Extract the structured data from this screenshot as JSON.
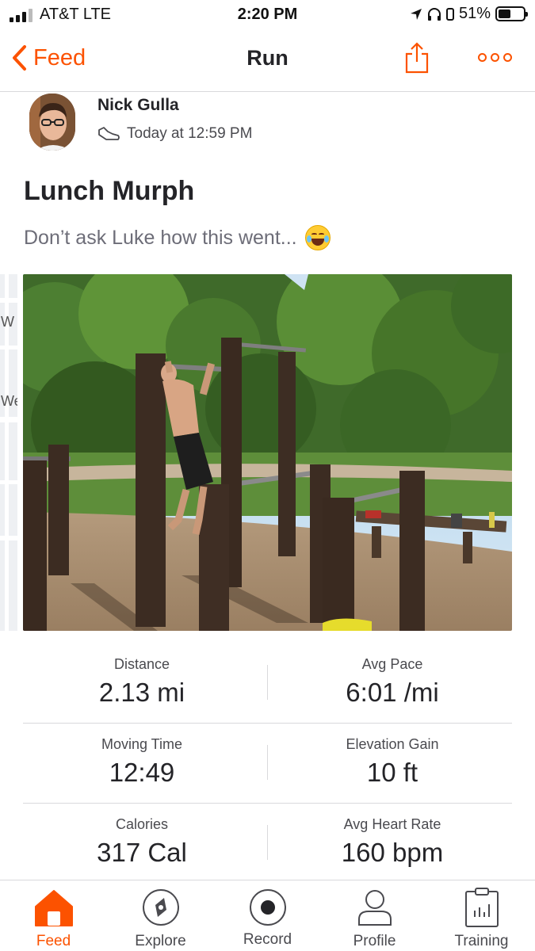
{
  "status_bar": {
    "carrier": "AT&T  LTE",
    "time": "2:20 PM",
    "battery": "51%"
  },
  "nav": {
    "back_label": "Feed",
    "title": "Run"
  },
  "activity": {
    "athlete_name": "Nick Gulla",
    "timestamp": "Today at 12:59 PM",
    "title": "Lunch Murph",
    "description": "Don’t ask Luke how this went..."
  },
  "map_labels": [
    "W",
    "We"
  ],
  "stats": [
    {
      "left_label": "Distance",
      "left_value": "2.13 mi",
      "right_label": "Avg Pace",
      "right_value": "6:01 /mi"
    },
    {
      "left_label": "Moving Time",
      "left_value": "12:49",
      "right_label": "Elevation Gain",
      "right_value": "10 ft"
    },
    {
      "left_label": "Calories",
      "left_value": "317 Cal",
      "right_label": "Avg Heart Rate",
      "right_value": "160 bpm"
    }
  ],
  "tab_bar": [
    {
      "label": "Feed",
      "icon": "home-icon",
      "active": true
    },
    {
      "label": "Explore",
      "icon": "compass-icon",
      "active": false
    },
    {
      "label": "Record",
      "icon": "record-icon",
      "active": false
    },
    {
      "label": "Profile",
      "icon": "profile-icon",
      "active": false
    },
    {
      "label": "Training",
      "icon": "training-icon",
      "active": false
    }
  ],
  "colors": {
    "accent": "#fc5200",
    "text": "#242428",
    "secondary_text": "#6d6d78",
    "divider": "#d9d9dc"
  }
}
